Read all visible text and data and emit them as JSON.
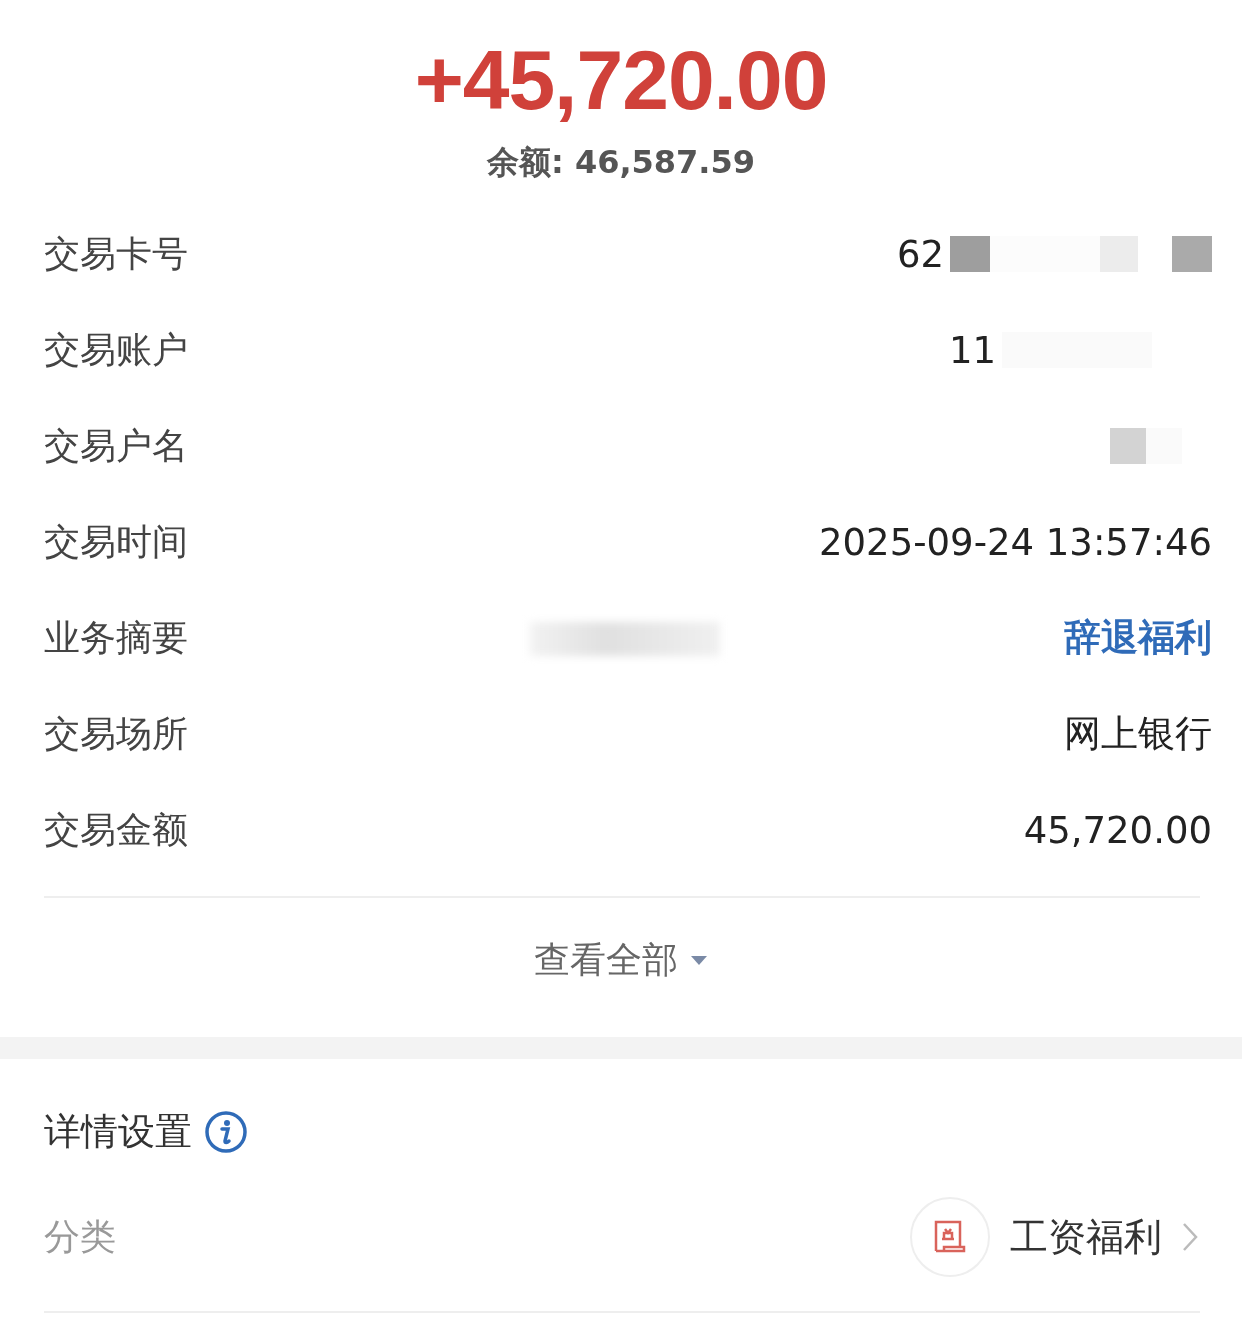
{
  "amount": "+45,720.00",
  "balance": {
    "label": "余额:",
    "value": "46,587.59"
  },
  "rows": [
    {
      "label": "交易卡号",
      "value": "62",
      "kind": "text",
      "redacted": true
    },
    {
      "label": "交易账户",
      "value": "11",
      "kind": "text",
      "redacted": true
    },
    {
      "label": "交易户名",
      "kind": "text",
      "redacted": true
    },
    {
      "label": "交易时间",
      "value": "2025-09-24 13:57:46",
      "kind": "text"
    },
    {
      "label": "业务摘要",
      "value": "辞退福利",
      "kind": "link",
      "redacted": true
    },
    {
      "label": "交易场所",
      "value": "网上银行",
      "kind": "text"
    },
    {
      "label": "交易金额",
      "value": "45,720.00",
      "kind": "text"
    }
  ],
  "expand": {
    "label": "查看全部",
    "expanded": false
  },
  "details": {
    "title": "详情设置",
    "category": {
      "label": "分类",
      "value": "工资福利"
    }
  }
}
